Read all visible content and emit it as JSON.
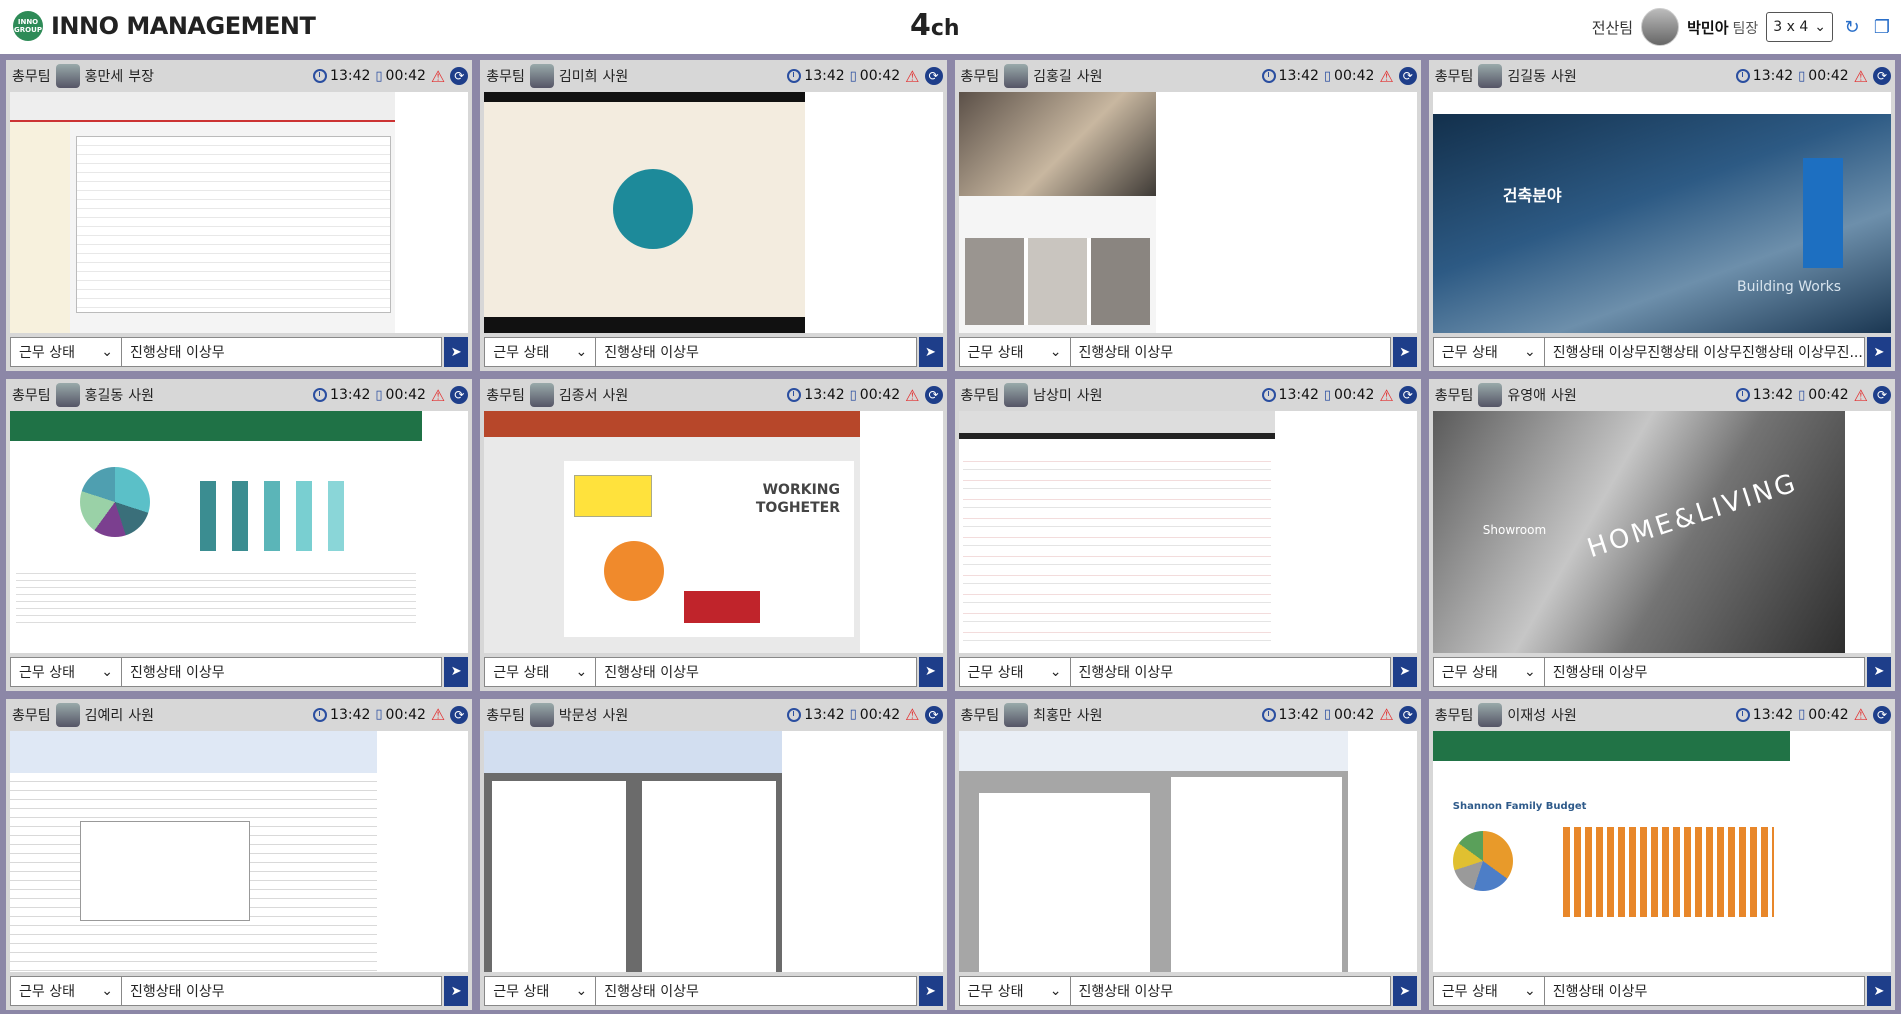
{
  "app": {
    "logo_badge_top": "INNO",
    "logo_badge_bottom": "GROUP",
    "title_bold": "INNO",
    "title_rest": " MANAGEMENT",
    "channel_num": "4",
    "channel_unit": "ch"
  },
  "user": {
    "dept": "전산팀",
    "name": "박민아",
    "role": "팀장"
  },
  "grid_select": {
    "value": "3 x 4"
  },
  "common": {
    "time": "13:42",
    "duration": "00:42",
    "status_label": "근무 상태",
    "send_glyph": "➤"
  },
  "cells": [
    {
      "team": "총무팀",
      "name": "홍만세",
      "rank": "부장",
      "status_text": "진행상태 이상무",
      "thumb": "admin"
    },
    {
      "team": "총무팀",
      "name": "김미희",
      "rank": "사원",
      "status_text": "진행상태 이상무",
      "thumb": "diagram"
    },
    {
      "team": "총무팀",
      "name": "김홍길",
      "rank": "사원",
      "status_text": "진행상태 이상무",
      "thumb": "interior"
    },
    {
      "team": "총무팀",
      "name": "김길동",
      "rank": "사원",
      "status_text": "진행상태 이상무진행상태 이상무진행상태 이상무진...",
      "thumb": "bridge"
    },
    {
      "team": "총무팀",
      "name": "홍길동",
      "rank": "사원",
      "status_text": "진행상태 이상무",
      "thumb": "excel"
    },
    {
      "team": "총무팀",
      "name": "김종서",
      "rank": "사원",
      "status_text": "진행상태 이상무",
      "thumb": "powerpoint"
    },
    {
      "team": "총무팀",
      "name": "남상미",
      "rank": "사원",
      "status_text": "진행상태 이상무",
      "thumb": "form"
    },
    {
      "team": "총무팀",
      "name": "유영애",
      "rank": "사원",
      "status_text": "진행상태 이상무",
      "thumb": "showroom"
    },
    {
      "team": "총무팀",
      "name": "김예리",
      "rank": "사원",
      "status_text": "진행상태 이상무",
      "thumb": "excel-chart"
    },
    {
      "team": "총무팀",
      "name": "박문성",
      "rank": "사원",
      "status_text": "진행상태 이상무",
      "thumb": "word-doc"
    },
    {
      "team": "총무팀",
      "name": "최홍만",
      "rank": "사원",
      "status_text": "진행상태 이상무",
      "thumb": "hwp-doc"
    },
    {
      "team": "총무팀",
      "name": "이재성",
      "rank": "사원",
      "status_text": "진행상태 이상무",
      "thumb": "excel-budget"
    }
  ],
  "thumb_text": {
    "bridge_title": "건축분야",
    "bridge_tag": "Building Works",
    "ppt_title_1": "WORKING",
    "ppt_title_2": "TOGHETER",
    "showroom_label": "Showroom",
    "showroom_brand": "HOME&LIVING",
    "budget_title": "Shannon Family Budget"
  },
  "icons": {
    "clock": "clock-icon",
    "usage": "bookmark-icon",
    "alert": "warning-icon",
    "sync": "sync-icon",
    "refresh": "refresh-icon",
    "window": "window-icon"
  },
  "colors": {
    "grid_bg": "#8c87a7",
    "cell_bg": "#d7d7d7",
    "accent": "#1e3e8a",
    "alert": "#e23030"
  }
}
